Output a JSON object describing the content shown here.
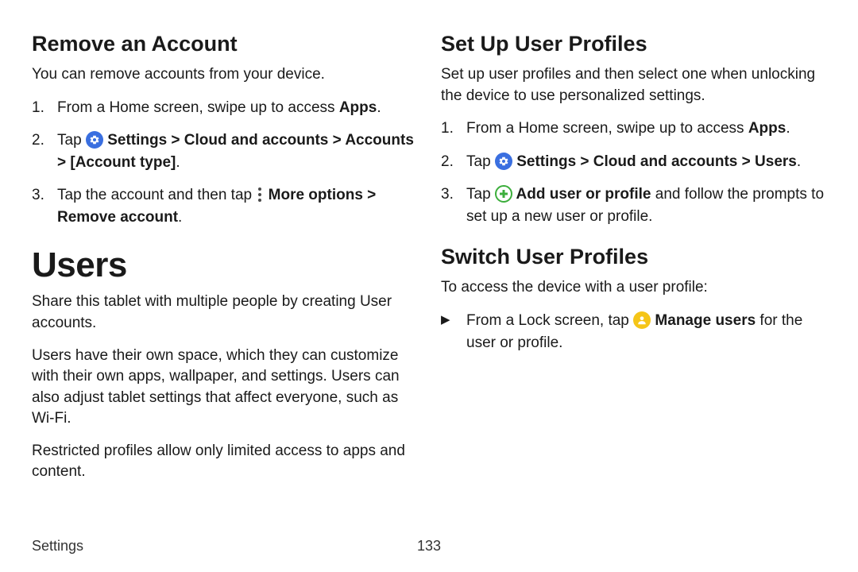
{
  "left": {
    "h_remove": "Remove an Account",
    "p_remove": "You can remove accounts from your device.",
    "step1_a": "From a Home screen, swipe up to access ",
    "step1_b": "Apps",
    "step1_c": ".",
    "step2_a": "Tap ",
    "step2_b": " Settings > Cloud and accounts > Accounts > [Account type]",
    "step2_c": ".",
    "step3_a": "Tap the account and then tap ",
    "step3_b": " More options > Remove account",
    "step3_c": ".",
    "h_users": "Users",
    "p_users1": "Share this tablet with multiple people by creating User accounts.",
    "p_users2": "Users have their own space, which they can customize with their own apps, wallpaper, and settings. Users can also adjust tablet settings that affect everyone, such as Wi‑Fi.",
    "p_users3": "Restricted profiles allow only limited access to apps and content."
  },
  "right": {
    "h_setup": "Set Up User Profiles",
    "p_setup": "Set up user profiles and then select one when unlocking the device to use personalized settings.",
    "s1_a": "From a Home screen, swipe up to access ",
    "s1_b": "Apps",
    "s1_c": ".",
    "s2_a": "Tap ",
    "s2_b": " Settings > Cloud and accounts > Users",
    "s2_c": ".",
    "s3_a": "Tap ",
    "s3_b": " Add user or profile",
    "s3_c": " and follow the prompts to set up a new user or profile.",
    "h_switch": "Switch User Profiles",
    "p_switch": "To access the device with a user profile:",
    "sw_a": "From a Lock screen, tap ",
    "sw_b": " Manage users",
    "sw_c": " for the user or profile."
  },
  "nums": {
    "n1": "1.",
    "n2": "2.",
    "n3": "3.",
    "tri": "▶"
  },
  "footer": {
    "section": "Settings",
    "page": "133"
  }
}
